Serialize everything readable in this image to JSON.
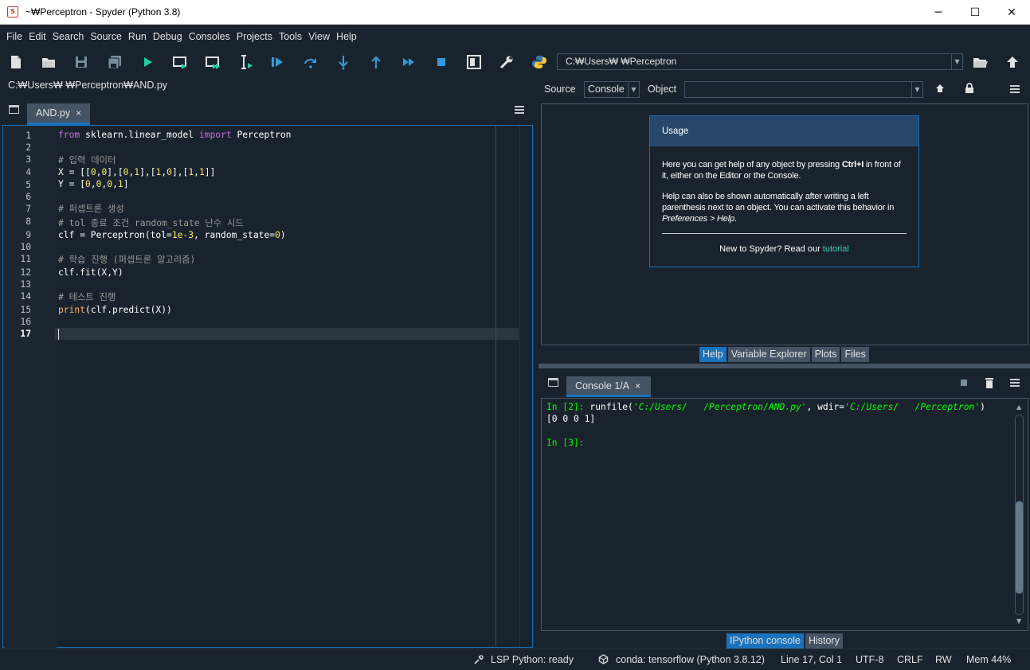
{
  "window": {
    "title": "~₩Perceptron - Spyder (Python 3.8)",
    "app_icon": "spyder-icon",
    "buttons": [
      "─",
      "☐",
      "✕"
    ]
  },
  "menu": [
    "File",
    "Edit",
    "Search",
    "Source",
    "Run",
    "Debug",
    "Consoles",
    "Projects",
    "Tools",
    "View",
    "Help"
  ],
  "toolbar": {
    "icons": [
      "new-file-icon",
      "open-folder-icon",
      "save-icon",
      "save-all-icon",
      "run-icon",
      "run-cell-icon",
      "run-cell-advance-icon",
      "run-selection-icon",
      "debug-icon",
      "step-over-icon",
      "step-into-icon",
      "step-return-icon",
      "continue-icon",
      "stop-icon",
      "maximize-pane-icon",
      "preferences-icon",
      "python-path-icon",
      "browse-folder-icon",
      "parent-dir-icon"
    ],
    "working_dir": "C:₩Users₩       ₩Perceptron"
  },
  "editor": {
    "path": "C:₩Users₩       ₩Perceptron₩AND.py",
    "tab_label": "AND.py",
    "tab_close": "×",
    "current_line": 17,
    "lines": [
      {
        "n": "1",
        "t": "from sklearn.linear_model import Perceptron"
      },
      {
        "n": "2",
        "t": ""
      },
      {
        "n": "3",
        "t": "# 입력 데이터"
      },
      {
        "n": "4",
        "t": "X = [[0,0],[0,1],[1,0],[1,1]]"
      },
      {
        "n": "5",
        "t": "Y = [0,0,0,1]"
      },
      {
        "n": "6",
        "t": ""
      },
      {
        "n": "7",
        "t": "# 퍼셉트론 생성"
      },
      {
        "n": "8",
        "t": "# tol 종료 조건 random_state 난수 시드"
      },
      {
        "n": "9",
        "t": "clf = Perceptron(tol=1e-3, random_state=0)"
      },
      {
        "n": "10",
        "t": ""
      },
      {
        "n": "11",
        "t": "# 학습 진행 (퍼셉트론 알고리즘)"
      },
      {
        "n": "12",
        "t": "clf.fit(X,Y)"
      },
      {
        "n": "13",
        "t": ""
      },
      {
        "n": "14",
        "t": "# 테스트 진행"
      },
      {
        "n": "15",
        "t": "print(clf.predict(X))"
      },
      {
        "n": "16",
        "t": ""
      },
      {
        "n": "17",
        "t": ""
      }
    ]
  },
  "help": {
    "source_label": "Source",
    "source_value": "Console",
    "object_label": "Object",
    "object_value": "",
    "usage_title": "Usage",
    "p1_a": "Here you can get help of any object by pressing ",
    "p1_key": "Ctrl+I",
    "p1_b": " in front of it, either on the Editor or the Console.",
    "p2_a": "Help can also be shown automatically after writing a left parenthesis next to an object. You can activate this behavior in ",
    "p2_em": "Preferences > Help",
    "p2_b": ".",
    "footer_a": "New to Spyder? Read our ",
    "footer_link": "tutorial",
    "tabs": [
      "Help",
      "Variable Explorer",
      "Plots",
      "Files"
    ],
    "active_tab": "Help"
  },
  "console": {
    "tab_label": "Console 1/A",
    "tab_close": "×",
    "prompt1": "In [2]: ",
    "cmd_a": "runfile(",
    "arg1": "'C:/Users/   /Perceptron/AND.py'",
    "cmd_b": ", wdir=",
    "arg2": "'C:/Users/   /Perceptron'",
    "cmd_c": ")",
    "output": "[0 0 0 1]",
    "prompt2": "In [3]:",
    "tabs": [
      "IPython console",
      "History"
    ],
    "active_tab": "IPython console"
  },
  "status": {
    "lsp": "LSP Python: ready",
    "conda": "conda: tensorflow (Python 3.8.12)",
    "position": "Line 17, Col 1",
    "encoding": "UTF-8",
    "eol": "CRLF",
    "rw": "RW",
    "mem": "Mem 44%"
  },
  "colors": {
    "background": "#19232d",
    "accent": "#1a72bb",
    "keyword": "#c670e0",
    "number": "#faed5c",
    "comment": "#999999",
    "prompt": "#00ff00"
  }
}
